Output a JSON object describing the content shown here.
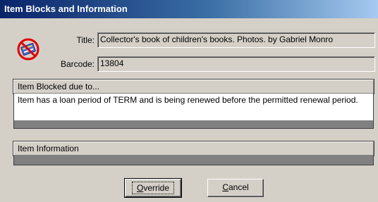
{
  "window": {
    "title": "Item Blocks and Information"
  },
  "icons": {
    "status": "no-entry-book-icon"
  },
  "fields": {
    "title_label": "Title:",
    "title_value": "Collector's book of children's books. Photos. by Gabriel Monro",
    "barcode_label": "Barcode:",
    "barcode_value": "13804"
  },
  "blocked": {
    "heading": "Item Blocked due to...",
    "message": "Item has a loan period of TERM and is being renewed before the permitted renewal period."
  },
  "info": {
    "heading": "Item Information"
  },
  "buttons": {
    "override_mnemonic": "O",
    "override_rest": "verride",
    "cancel_mnemonic": "C",
    "cancel_rest": "ancel"
  }
}
